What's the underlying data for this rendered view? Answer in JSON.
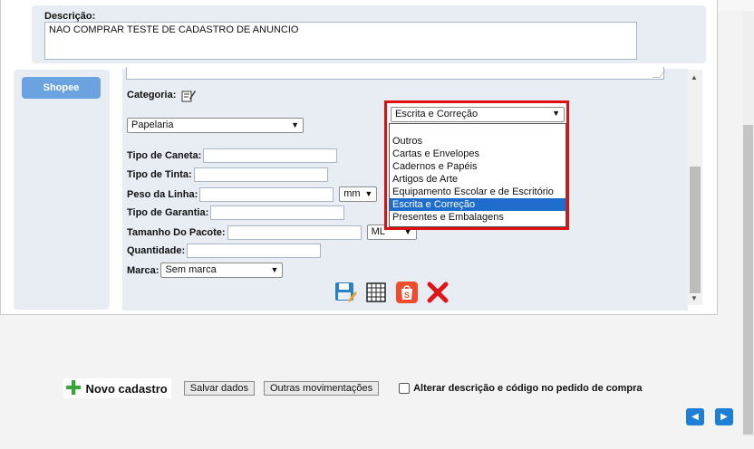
{
  "description": {
    "label": "Descrição:",
    "value": "NAO COMPRAR TESTE DE CADASTRO DE ANUNCIO"
  },
  "sidebar": {
    "shopee_button": "Shopee"
  },
  "form": {
    "categoria_label": "Categoria:",
    "categoria_value": "Papelaria",
    "tipo_caneta_label": "Tipo de Caneta:",
    "tipo_tinta_label": "Tipo de Tinta:",
    "peso_linha_label": "Peso da Linha:",
    "peso_unit": "mm",
    "tipo_garantia_label": "Tipo de Garantia:",
    "tamanho_pacote_label": "Tamanho Do Pacote:",
    "tamanho_unit": "ML",
    "quantidade_label": "Quantidade:",
    "marca_label": "Marca:",
    "marca_value": "Sem marca"
  },
  "subcategory_dropdown": {
    "selected": "Escrita e Correção",
    "options": [
      "Outros",
      "Cartas e Envelopes",
      "Cadernos e Papéis",
      "Artigos de Arte",
      "Equipamento Escolar e de Escritório",
      "Escrita e Correção",
      "Presentes e Embalagens"
    ],
    "selected_index": 5
  },
  "icons": [
    "save-icon",
    "grid-icon",
    "shopee-bag-icon",
    "delete-x-icon"
  ],
  "bottom": {
    "novo_cadastro": "Novo cadastro",
    "salvar_dados": "Salvar dados",
    "outras_movimentacoes": "Outras movimentações",
    "alterar_label": "Alterar descrição e código no pedido de compra"
  },
  "colors": {
    "accent": "#1d7fd6",
    "highlight_border": "#e01010",
    "selected_option": "#1e6ccc"
  }
}
